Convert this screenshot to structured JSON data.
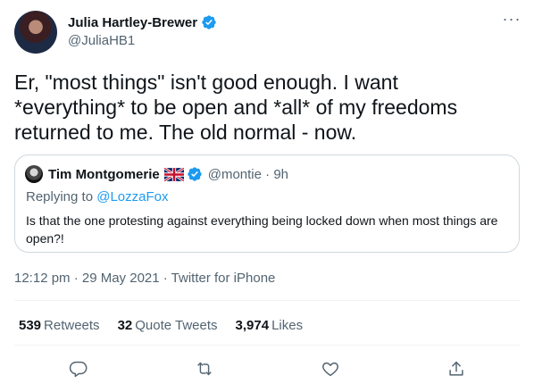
{
  "tweet": {
    "author_name": "Julia Hartley-Brewer",
    "author_handle": "@JuliaHB1",
    "text": "Er, \"most things\" isn't good enough. I want\n*everything* to be open and *all* of my freedoms\nreturned to me. The old normal - now.",
    "timestamp": "12:12 pm · 29 May 2021 · ",
    "source": "Twitter for iPhone"
  },
  "quote": {
    "author_name": "Tim Montgomerie",
    "author_handle": "@montie · 9h",
    "replying_prefix": "Replying to ",
    "replying_to": "@LozzaFox",
    "text": "Is that the one protesting against everything being locked down when most things are open?!"
  },
  "stats": {
    "retweets_count": "539",
    "retweets_label": "Retweets",
    "quotes_count": "32",
    "quotes_label": "Quote Tweets",
    "likes_count": "3,974",
    "likes_label": "Likes"
  },
  "icons": {
    "more": "more-icon",
    "reply": "reply-icon",
    "retweet": "retweet-icon",
    "like": "like-icon",
    "share": "share-icon",
    "verified": "verified-badge-icon",
    "flag": "uk-flag-icon"
  },
  "colors": {
    "accent": "#1d9bf0",
    "secondary_text": "#536471",
    "border": "#cfd9de"
  }
}
